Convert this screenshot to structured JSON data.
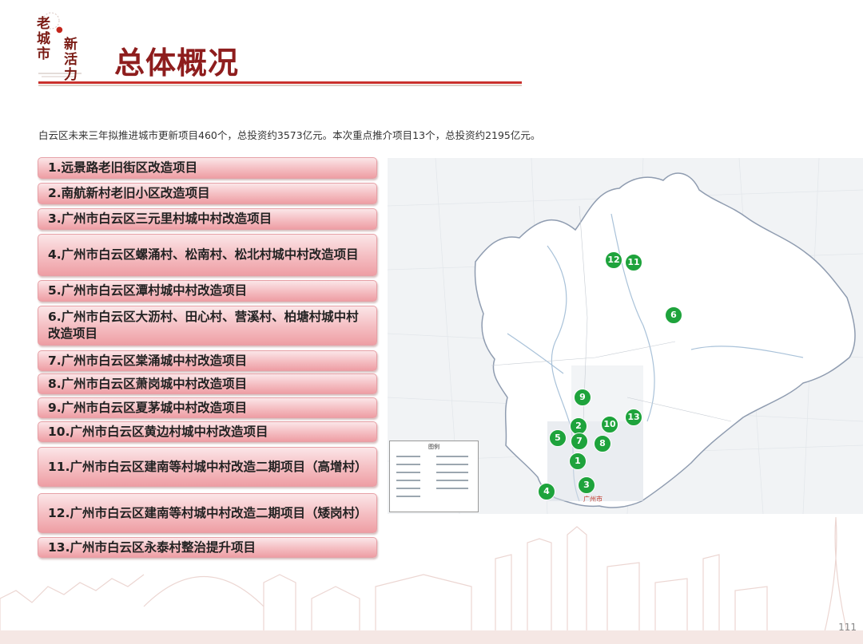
{
  "logo": {
    "chars_left": [
      "老",
      "城",
      "市"
    ],
    "chars_right": [
      "新",
      "活",
      "力"
    ]
  },
  "title": "总体概况",
  "summary": "白云区未来三年拟推进城市更新项目460个，总投资约3573亿元。本次重点推介项目13个，总投资约2195亿元。",
  "projects": [
    {
      "label": "1.远景路老旧街区改造项目"
    },
    {
      "label": "2.南航新村老旧小区改造项目"
    },
    {
      "label": "3.广州市白云区三元里村城中村改造项目"
    },
    {
      "label": "4.广州市白云区螺涌村、松南村、松北村城中村改造项目"
    },
    {
      "label": "5.广州市白云区潭村城中村改造项目"
    },
    {
      "label": "6.广州市白云区大沥村、田心村、营溪村、柏塘村城中村改造项目"
    },
    {
      "label": "7.广州市白云区棠涌城中村改造项目"
    },
    {
      "label": "8.广州市白云区萧岗城中村改造项目"
    },
    {
      "label": "9.广州市白云区夏茅城中村改造项目"
    },
    {
      "label": "10.广州市白云区黄边村城中村改造项目"
    },
    {
      "label": "11.广州市白云区建南等村城中村改造二期项目（高增村）"
    },
    {
      "label": "12.广州市白云区建南等村城中村改造二期项目（矮岗村）"
    },
    {
      "label": "13.广州市白云区永泰村整治提升项目"
    }
  ],
  "map": {
    "legend_title": "图例",
    "place_label": "广州市",
    "marker_color": "#1ea33c",
    "markers": [
      {
        "label": "12"
      },
      {
        "label": "11"
      },
      {
        "label": "6"
      },
      {
        "label": "9"
      },
      {
        "label": "2"
      },
      {
        "label": "10"
      },
      {
        "label": "13"
      },
      {
        "label": "5"
      },
      {
        "label": "7"
      },
      {
        "label": "8"
      },
      {
        "label": "1"
      },
      {
        "label": "4"
      },
      {
        "label": "3"
      }
    ]
  },
  "page_number": "111"
}
